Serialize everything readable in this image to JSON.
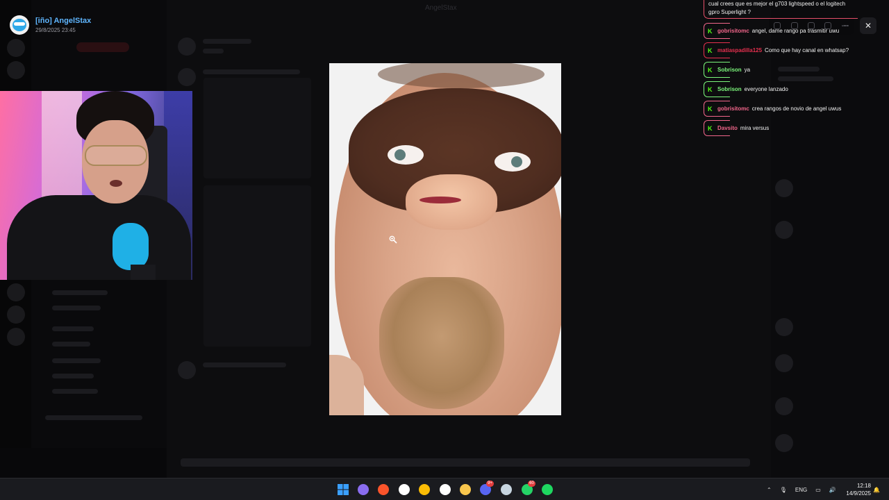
{
  "viewer": {
    "username": "[iño] AngelStax",
    "timestamp": "29/8/2025 23:45",
    "title": "AngelStax"
  },
  "chat": {
    "top_message": "cual crees que es mejor el g703 lightspeed o el logitech gpro Superlight ?",
    "kick_glyph": "K",
    "messages": [
      {
        "user": "gobrisitomc",
        "text": "angel, dame rango pa trasmitir uwu",
        "color": "#f2668b"
      },
      {
        "user": "matiaspadilla125",
        "text": "Como que hay canal en whatsap?",
        "color": "#e8304f"
      },
      {
        "user": "Sobrison",
        "text": "ya",
        "color": "#7cf77c"
      },
      {
        "user": "Sobrison",
        "text": "everyone lanzado",
        "color": "#7cf77c"
      },
      {
        "user": "gobrisitomc",
        "text": "crea rangos de novio de angel uwus",
        "color": "#f2668b"
      },
      {
        "user": "Davsito",
        "text": "mira versus",
        "color": "#f2668b"
      }
    ]
  },
  "toolbar": {
    "icons": [
      "zoom-icon",
      "rotate-icon",
      "download-icon",
      "open-external-icon",
      "more-icon"
    ],
    "close_glyph": "✕"
  },
  "taskbar": {
    "icons": [
      {
        "name": "windows-start-icon",
        "color": "#3aa0ff"
      },
      {
        "name": "copilot-icon",
        "color": "#8a6df0"
      },
      {
        "name": "brave-icon",
        "color": "#fb542b"
      },
      {
        "name": "notion-icon",
        "color": "#ffffff"
      },
      {
        "name": "chrome-icon",
        "color": "#fbbc05"
      },
      {
        "name": "calendar-icon",
        "color": "#ffffff"
      },
      {
        "name": "file-explorer-icon",
        "color": "#f8c64d"
      },
      {
        "name": "discord-icon",
        "color": "#5865f2",
        "badge": "9+"
      },
      {
        "name": "steam-icon",
        "color": "#c7d5e0"
      },
      {
        "name": "whatsapp-icon",
        "color": "#25d366",
        "badge": "60"
      },
      {
        "name": "spotify-icon",
        "color": "#1ed760"
      }
    ],
    "tray": {
      "language": "ENG",
      "time": "12:18",
      "date": "14/9/2025"
    }
  }
}
